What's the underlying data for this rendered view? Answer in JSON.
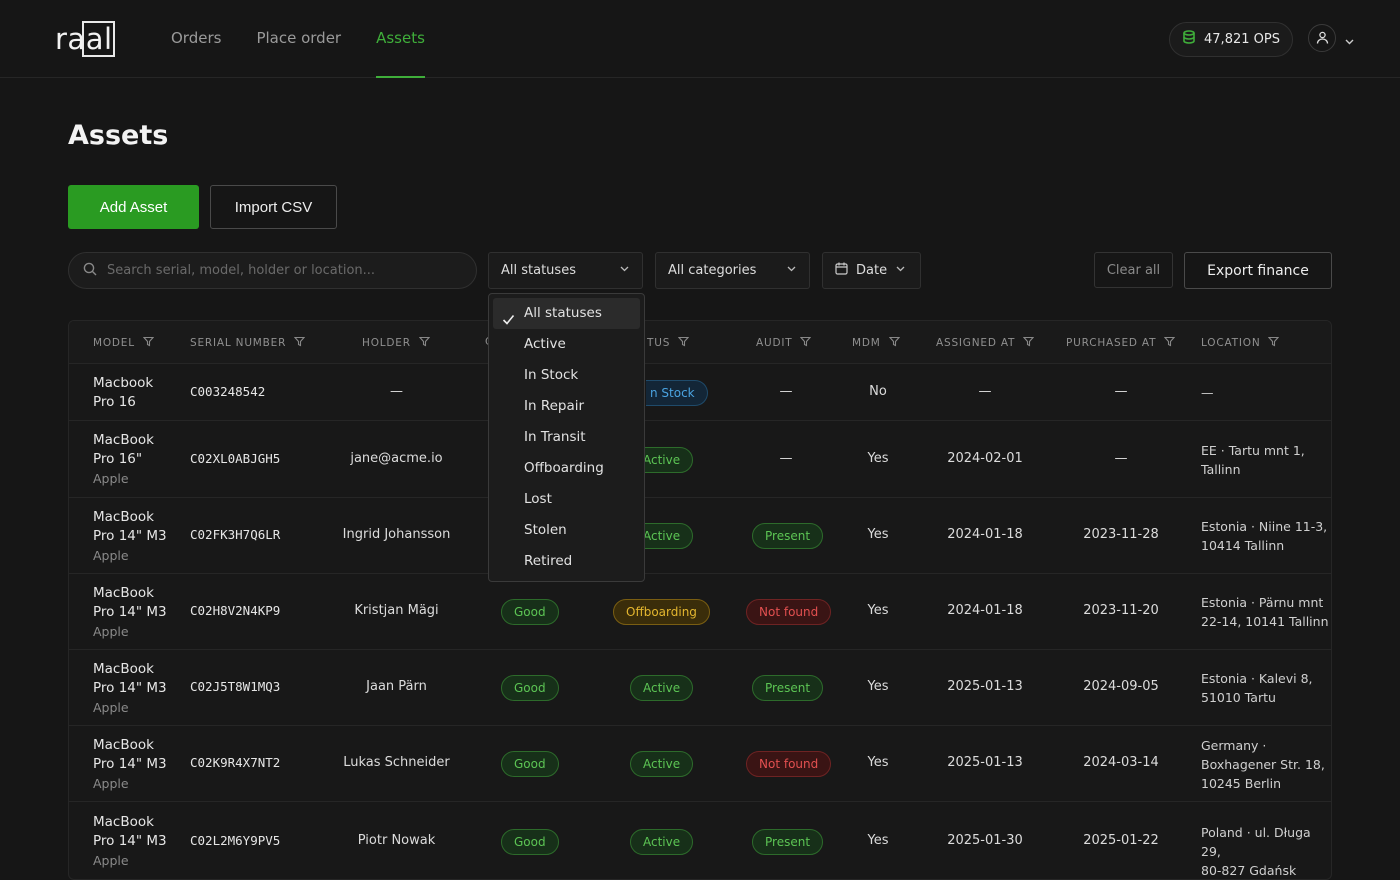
{
  "brand": {
    "logo_text": "raal"
  },
  "nav": {
    "items": [
      "Orders",
      "Place order",
      "Assets"
    ],
    "active": "Assets"
  },
  "header": {
    "ops_balance": "47,821 OPS"
  },
  "page": {
    "title": "Assets"
  },
  "actions": {
    "add_asset": "Add Asset",
    "import_csv": "Import CSV",
    "clear_all": "Clear all",
    "export_finance": "Export finance"
  },
  "filters": {
    "search_placeholder": "Search serial, model, holder or location...",
    "status_value": "All statuses",
    "category_value": "All categories",
    "date_label": "Date"
  },
  "status_dropdown": {
    "options": [
      "All statuses",
      "Active",
      "In Stock",
      "In Repair",
      "In Transit",
      "Offboarding",
      "Lost",
      "Stolen",
      "Retired"
    ],
    "selected": "All statuses"
  },
  "table": {
    "columns": [
      "MODEL",
      "SERIAL NUMBER",
      "HOLDER",
      "CONDITION",
      "STATUS",
      "AUDIT",
      "MDM",
      "ASSIGNED AT",
      "PURCHASED AT",
      "LOCATION"
    ],
    "visible_headers": {
      "model": "MODEL",
      "serial": "SERIAL NUMBER",
      "holder": "HOLDER",
      "condition_partial": "C",
      "status_partial": "TUS",
      "audit": "AUDIT",
      "mdm": "MDM",
      "assigned": "ASSIGNED AT",
      "purchased": "PURCHASED AT",
      "location": "LOCATION"
    },
    "rows": [
      {
        "model_line1": "Macbook",
        "model_line2": "Pro 16",
        "brand": "",
        "serial": "C003248542",
        "holder": "—",
        "condition": "",
        "status": "In Stock",
        "status_visible": "n Stock",
        "audit": "—",
        "mdm": "No",
        "assigned": "—",
        "purchased": "—",
        "loc1": "—",
        "loc2": "",
        "loc3": ""
      },
      {
        "model_line1": "MacBook",
        "model_line2": "Pro 16\"",
        "brand": "Apple",
        "serial": "C02XL0ABJGH5",
        "holder": "jane@acme.io",
        "condition": "",
        "status": "Active",
        "status_visible": "Active",
        "audit": "—",
        "mdm": "Yes",
        "assigned": "2024-02-01",
        "purchased": "—",
        "loc1": "EE · Tartu mnt 1,",
        "loc2": "Tallinn",
        "loc3": ""
      },
      {
        "model_line1": "MacBook",
        "model_line2": "Pro 14\" M3",
        "brand": "Apple",
        "serial": "C02FK3H7Q6LR",
        "holder": "Ingrid Johansson",
        "condition": "",
        "status": "Active",
        "status_visible": "Active",
        "audit": "Present",
        "mdm": "Yes",
        "assigned": "2024-01-18",
        "purchased": "2023-11-28",
        "loc1": "Estonia · Niine 11-3,",
        "loc2": "10414 Tallinn",
        "loc3": ""
      },
      {
        "model_line1": "MacBook",
        "model_line2": "Pro 14\" M3",
        "brand": "Apple",
        "serial": "C02H8V2N4KP9",
        "holder": "Kristjan Mägi",
        "condition": "Good",
        "status": "Offboarding",
        "status_visible": "Offboarding",
        "audit": "Not found",
        "mdm": "Yes",
        "assigned": "2024-01-18",
        "purchased": "2023-11-20",
        "loc1": "Estonia · Pärnu mnt",
        "loc2": "22-14, 10141 Tallinn",
        "loc3": ""
      },
      {
        "model_line1": "MacBook",
        "model_line2": "Pro 14\" M3",
        "brand": "Apple",
        "serial": "C02J5T8W1MQ3",
        "holder": "Jaan Pärn",
        "condition": "Good",
        "status": "Active",
        "status_visible": "Active",
        "audit": "Present",
        "mdm": "Yes",
        "assigned": "2025-01-13",
        "purchased": "2024-09-05",
        "loc1": "Estonia · Kalevi 8,",
        "loc2": "51010 Tartu",
        "loc3": ""
      },
      {
        "model_line1": "MacBook",
        "model_line2": "Pro 14\" M3",
        "brand": "Apple",
        "serial": "C02K9R4X7NT2",
        "holder": "Lukas Schneider",
        "condition": "Good",
        "status": "Active",
        "status_visible": "Active",
        "audit": "Not found",
        "mdm": "Yes",
        "assigned": "2025-01-13",
        "purchased": "2024-03-14",
        "loc1": "Germany ·",
        "loc2": "Boxhagener Str. 18,",
        "loc3": "10245 Berlin"
      },
      {
        "model_line1": "MacBook",
        "model_line2": "Pro 14\" M3",
        "brand": "Apple",
        "serial": "C02L2M6Y9PV5",
        "holder": "Piotr Nowak",
        "condition": "Good",
        "status": "Active",
        "status_visible": "Active",
        "audit": "Present",
        "mdm": "Yes",
        "assigned": "2025-01-30",
        "purchased": "2025-01-22",
        "loc1": "Poland · ul. Długa 29,",
        "loc2": "80-827 Gdańsk",
        "loc3": ""
      }
    ]
  },
  "colors": {
    "accent": "#2a9b22",
    "accent_text": "#3fae3a",
    "background": "#161616"
  }
}
